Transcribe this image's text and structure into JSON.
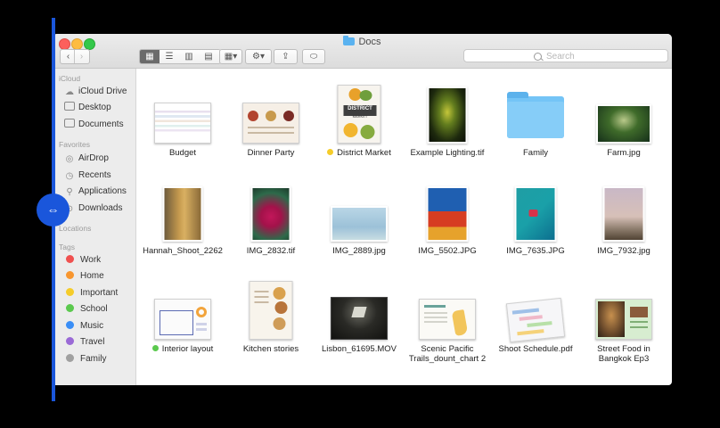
{
  "window": {
    "title": "Docs"
  },
  "toolbar": {
    "back_icon": "‹",
    "forward_icon": "›",
    "view_icons": [
      "▦",
      "☰",
      "▥",
      "▤"
    ],
    "arrange_icon": "▦▾",
    "action_icon": "⚙▾",
    "share_icon": "⇪",
    "tag_icon": "⬭",
    "search_placeholder": "Search"
  },
  "sidebar": {
    "sections": {
      "icloud": "iCloud",
      "favorites": "Favorites",
      "locations": "Locations",
      "tags": "Tags"
    },
    "icloud_items": [
      {
        "label": "iCloud Drive",
        "icon": "☁"
      },
      {
        "label": "Desktop",
        "icon": "▭"
      },
      {
        "label": "Documents",
        "icon": "▭"
      }
    ],
    "favorite_items": [
      {
        "label": "AirDrop",
        "icon": "◎"
      },
      {
        "label": "Recents",
        "icon": "◷"
      },
      {
        "label": "Applications",
        "icon": "⚲"
      },
      {
        "label": "Downloads",
        "icon": "⊙"
      }
    ],
    "tag_items": [
      {
        "label": "Work",
        "color": "#f0504f"
      },
      {
        "label": "Home",
        "color": "#f8962f"
      },
      {
        "label": "Important",
        "color": "#f5cc2a"
      },
      {
        "label": "School",
        "color": "#5bc94e"
      },
      {
        "label": "Music",
        "color": "#3a8ef6"
      },
      {
        "label": "Travel",
        "color": "#9a6ad6"
      },
      {
        "label": "Family",
        "color": "#a0a0a0"
      }
    ]
  },
  "files": [
    {
      "name": "Budget",
      "tag": ""
    },
    {
      "name": "Dinner Party",
      "tag": ""
    },
    {
      "name": "District Market",
      "tag": "#f5cc2a"
    },
    {
      "name": "Example Lighting.tif",
      "tag": ""
    },
    {
      "name": "Family",
      "tag": ""
    },
    {
      "name": "Farm.jpg",
      "tag": ""
    },
    {
      "name": "Hannah_Shoot_2262",
      "tag": ""
    },
    {
      "name": "IMG_2832.tif",
      "tag": ""
    },
    {
      "name": "IMG_2889.jpg",
      "tag": ""
    },
    {
      "name": "IMG_5502.JPG",
      "tag": ""
    },
    {
      "name": "IMG_7635.JPG",
      "tag": ""
    },
    {
      "name": "IMG_7932.jpg",
      "tag": ""
    },
    {
      "name": "Interior layout",
      "tag": "#5bc94e"
    },
    {
      "name": "Kitchen stories",
      "tag": ""
    },
    {
      "name": "Lisbon_61695.MOV",
      "tag": ""
    },
    {
      "name": "Scenic Pacific Trails_dount_chart 2",
      "tag": ""
    },
    {
      "name": "Shoot Schedule.pdf",
      "tag": ""
    },
    {
      "name": "Street Food in Bangkok Ep3",
      "tag": ""
    }
  ],
  "thumb_texts": {
    "district_title": "DISTRICT",
    "district_sub": "MARKET"
  },
  "overlay": {
    "resize_handle_icon": "⇔"
  }
}
